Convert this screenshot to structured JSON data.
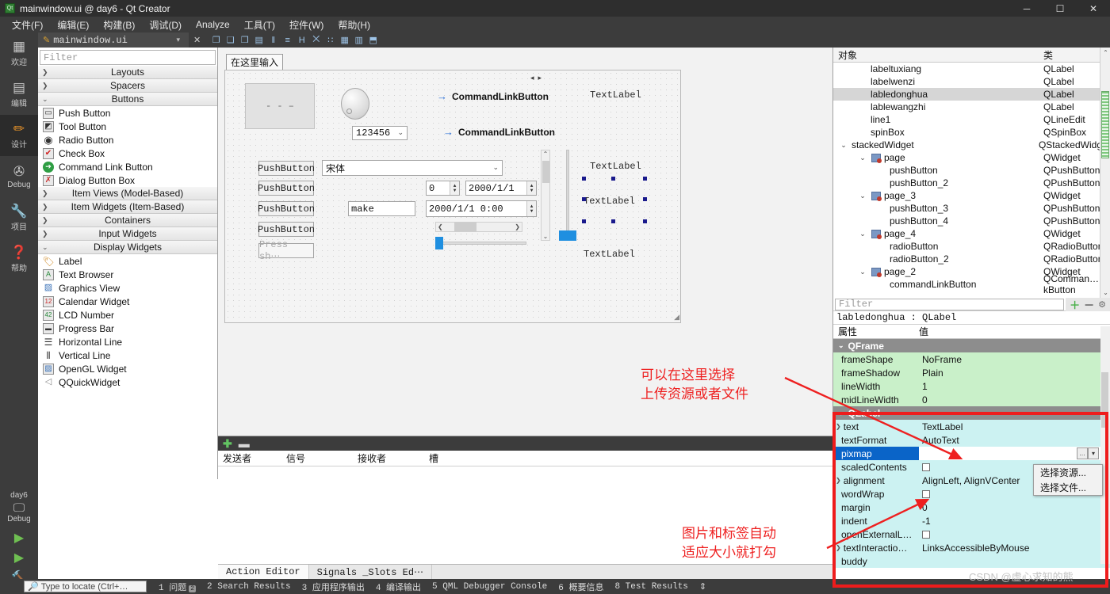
{
  "window": {
    "title": "mainwindow.ui @ day6 - Qt Creator",
    "app_icon": "qt-creator-icon",
    "minimize": "─",
    "maximize": "☐",
    "close": "✕"
  },
  "menubar": {
    "items": [
      {
        "label": "文件(F)"
      },
      {
        "label": "编辑(E)"
      },
      {
        "label": "构建(B)"
      },
      {
        "label": "调试(D)"
      },
      {
        "label": "Analyze"
      },
      {
        "label": "工具(T)"
      },
      {
        "label": "控件(W)"
      },
      {
        "label": "帮助(H)"
      }
    ]
  },
  "mode_rail": {
    "items": [
      {
        "label": "欢迎",
        "icon": "grid-icon",
        "glyph": "▓",
        "active": false
      },
      {
        "label": "编辑",
        "icon": "document-icon",
        "glyph": "☰",
        "active": false
      },
      {
        "label": "设计",
        "icon": "pencil-icon",
        "glyph": "╱",
        "active": true
      },
      {
        "label": "Debug",
        "icon": "bug-icon",
        "glyph": "✤",
        "active": false
      },
      {
        "label": "项目",
        "icon": "wrench-icon",
        "glyph": "⚒",
        "active": false
      },
      {
        "label": "帮助",
        "icon": "help-icon",
        "glyph": "?",
        "active": false
      }
    ],
    "kit_name": "day6",
    "kit_icon": "monitor-icon",
    "kit_label": "Debug",
    "run_buttons": [
      {
        "icon": "run-icon",
        "glyph": "▶"
      },
      {
        "icon": "debug-run-icon",
        "glyph": "▶"
      },
      {
        "icon": "build-hammer-icon",
        "glyph": "⚒"
      }
    ]
  },
  "editor_tab": {
    "filename": "mainwindow.ui",
    "pencil_icon": "pencil-edit-icon",
    "dropdown_icon": "chevron-down-icon",
    "close_icon": "close-icon",
    "form_tools": [
      {
        "icon": "edit-widgets-icon",
        "glyph": "❐"
      },
      {
        "icon": "edit-signals-slots-icon",
        "glyph": "❑"
      },
      {
        "icon": "edit-buddies-icon",
        "glyph": "❒"
      },
      {
        "icon": "edit-tab-order-icon",
        "glyph": "▤"
      },
      {
        "icon": "layout-horizontal-icon",
        "glyph": "‖"
      },
      {
        "icon": "layout-vertical-icon",
        "glyph": "≡"
      },
      {
        "icon": "layout-splitter-h-icon",
        "glyph": "H"
      },
      {
        "icon": "layout-splitter-v-icon",
        "glyph": "⨉"
      },
      {
        "icon": "layout-form-icon",
        "glyph": "∷"
      },
      {
        "icon": "layout-grid-icon",
        "glyph": "▦"
      },
      {
        "icon": "break-layout-icon",
        "glyph": "▥"
      },
      {
        "icon": "adjust-size-icon",
        "glyph": "⬒"
      }
    ]
  },
  "widget_box": {
    "filter_placeholder": "Filter",
    "categories": [
      {
        "label": "Layouts",
        "expanded": false,
        "items": []
      },
      {
        "label": "Spacers",
        "expanded": false,
        "items": []
      },
      {
        "label": "Buttons",
        "expanded": true,
        "items": [
          {
            "label": "Push Button",
            "icon": "push-button-icon",
            "glyph": "▭"
          },
          {
            "label": "Tool Button",
            "icon": "tool-button-icon",
            "glyph": "◩"
          },
          {
            "label": "Radio Button",
            "icon": "radio-button-icon",
            "glyph": "◉"
          },
          {
            "label": "Check Box",
            "icon": "check-box-icon",
            "glyph": "✔"
          },
          {
            "label": "Command Link Button",
            "icon": "command-link-button-icon",
            "glyph": "→"
          },
          {
            "label": "Dialog Button Box",
            "icon": "dialog-button-box-icon",
            "glyph": "✖"
          }
        ]
      },
      {
        "label": "Item Views (Model-Based)",
        "expanded": false,
        "items": []
      },
      {
        "label": "Item Widgets (Item-Based)",
        "expanded": false,
        "items": []
      },
      {
        "label": "Containers",
        "expanded": false,
        "items": []
      },
      {
        "label": "Input Widgets",
        "expanded": false,
        "items": []
      },
      {
        "label": "Display Widgets",
        "expanded": true,
        "items": [
          {
            "label": "Label",
            "icon": "label-icon",
            "glyph": "▱"
          },
          {
            "label": "Text Browser",
            "icon": "text-browser-icon",
            "glyph": "A"
          },
          {
            "label": "Graphics View",
            "icon": "graphics-view-icon",
            "glyph": "▨"
          },
          {
            "label": "Calendar Widget",
            "icon": "calendar-widget-icon",
            "glyph": "12"
          },
          {
            "label": "LCD Number",
            "icon": "lcd-number-icon",
            "glyph": "42"
          },
          {
            "label": "Progress Bar",
            "icon": "progress-bar-icon",
            "glyph": "▬"
          },
          {
            "label": "Horizontal Line",
            "icon": "horizontal-line-icon",
            "glyph": "☰"
          },
          {
            "label": "Vertical Line",
            "icon": "vertical-line-icon",
            "glyph": "‖"
          },
          {
            "label": "OpenGL Widget",
            "icon": "opengl-widget-icon",
            "glyph": "▧"
          },
          {
            "label": "QQuickWidget",
            "icon": "qquickwidget-icon",
            "glyph": "◁"
          }
        ]
      }
    ]
  },
  "form_editor": {
    "menu_placeholder": "在这里输入",
    "image_placeholder": "- -\n–",
    "dial_icon": "dial-widget",
    "combo_value": "123456",
    "font_combo_value": "宋体",
    "command_link_1": "CommandLinkButton",
    "command_link_2": "CommandLinkButton",
    "text_labels": [
      "TextLabel",
      "TextLabel",
      "TextLabel",
      "TextLabel"
    ],
    "push_buttons": [
      "PushButton",
      "PushButton",
      "PushButton",
      "PushButton"
    ],
    "key_sequence_edit": "Press sh⋯",
    "line_edit_value": "make",
    "spin_value": "0",
    "date_value": "2000/1/1",
    "datetime_value": "2000/1/1 0:00"
  },
  "signals_slots": {
    "add_icon": "plus-icon",
    "remove_icon": "minus-icon",
    "columns": [
      "发送者",
      "信号",
      "接收者",
      "槽"
    ],
    "rows": []
  },
  "bottom_tabs": [
    {
      "label": "Action Editor",
      "active": true
    },
    {
      "label": "Signals _Slots Ed⋯",
      "active": false
    }
  ],
  "object_inspector": {
    "columns": [
      "对象",
      "类"
    ],
    "rows": [
      {
        "indent": 2,
        "name": "labeltuxiang",
        "class": "QLabel",
        "twisty": "",
        "page_icon": false,
        "selected": false
      },
      {
        "indent": 2,
        "name": "labelwenzi",
        "class": "QLabel",
        "twisty": "",
        "page_icon": false,
        "selected": false
      },
      {
        "indent": 2,
        "name": "labledonghua",
        "class": "QLabel",
        "twisty": "",
        "page_icon": false,
        "selected": true
      },
      {
        "indent": 2,
        "name": "lablewangzhi",
        "class": "QLabel",
        "twisty": "",
        "page_icon": false,
        "selected": false
      },
      {
        "indent": 2,
        "name": "line1",
        "class": "QLineEdit",
        "twisty": "",
        "page_icon": false,
        "selected": false
      },
      {
        "indent": 2,
        "name": "spinBox",
        "class": "QSpinBox",
        "twisty": "",
        "page_icon": false,
        "selected": false
      },
      {
        "indent": 1,
        "name": "stackedWidget",
        "class": "QStackedWidget",
        "twisty": "⌄",
        "page_icon": false,
        "selected": false
      },
      {
        "indent": 2,
        "name": "page",
        "class": "QWidget",
        "twisty": "⌄",
        "page_icon": true,
        "selected": false
      },
      {
        "indent": 3,
        "name": "pushButton",
        "class": "QPushButton",
        "twisty": "",
        "page_icon": false,
        "selected": false
      },
      {
        "indent": 3,
        "name": "pushButton_2",
        "class": "QPushButton",
        "twisty": "",
        "page_icon": false,
        "selected": false
      },
      {
        "indent": 2,
        "name": "page_3",
        "class": "QWidget",
        "twisty": "⌄",
        "page_icon": true,
        "selected": false
      },
      {
        "indent": 3,
        "name": "pushButton_3",
        "class": "QPushButton",
        "twisty": "",
        "page_icon": false,
        "selected": false
      },
      {
        "indent": 3,
        "name": "pushButton_4",
        "class": "QPushButton",
        "twisty": "",
        "page_icon": false,
        "selected": false
      },
      {
        "indent": 2,
        "name": "page_4",
        "class": "QWidget",
        "twisty": "⌄",
        "page_icon": true,
        "selected": false
      },
      {
        "indent": 3,
        "name": "radioButton",
        "class": "QRadioButton",
        "twisty": "",
        "page_icon": false,
        "selected": false
      },
      {
        "indent": 3,
        "name": "radioButton_2",
        "class": "QRadioButton",
        "twisty": "",
        "page_icon": false,
        "selected": false
      },
      {
        "indent": 2,
        "name": "page_2",
        "class": "QWidget",
        "twisty": "⌄",
        "page_icon": true,
        "selected": false
      },
      {
        "indent": 3,
        "name": "commandLinkButton",
        "class": "QComman…kButton",
        "twisty": "",
        "page_icon": false,
        "selected": false
      }
    ]
  },
  "property_editor": {
    "filter_placeholder": "Filter",
    "toolbar_icons": [
      {
        "icon": "add-property-icon",
        "glyph": "＋"
      },
      {
        "icon": "remove-property-icon",
        "glyph": "－"
      },
      {
        "icon": "configure-icon",
        "glyph": "⚙"
      }
    ],
    "object_header": "labledonghua : QLabel",
    "columns": [
      "属性",
      "值"
    ],
    "groups": [
      {
        "name": "QFrame",
        "expanded": true,
        "rows": [
          {
            "name": "frameShape",
            "value": "NoFrame",
            "type": "text",
            "tint": "green",
            "twisty": false
          },
          {
            "name": "frameShadow",
            "value": "Plain",
            "type": "text",
            "tint": "green",
            "twisty": false
          },
          {
            "name": "lineWidth",
            "value": "1",
            "type": "text",
            "tint": "green",
            "twisty": false
          },
          {
            "name": "midLineWidth",
            "value": "0",
            "type": "text",
            "tint": "green",
            "twisty": false
          }
        ]
      },
      {
        "name": "QLabel",
        "expanded": true,
        "rows": [
          {
            "name": "text",
            "value": "TextLabel",
            "type": "text",
            "tint": "cyan",
            "twisty": true
          },
          {
            "name": "textFormat",
            "value": "AutoText",
            "type": "text",
            "tint": "cyan",
            "twisty": false
          },
          {
            "name": "pixmap",
            "value": "",
            "type": "pixmap",
            "tint": "sel",
            "twisty": false
          },
          {
            "name": "scaledContents",
            "value": "",
            "type": "checkbox",
            "tint": "cyan",
            "twisty": false
          },
          {
            "name": "alignment",
            "value": "AlignLeft, AlignVCenter",
            "type": "text",
            "tint": "cyan",
            "twisty": true
          },
          {
            "name": "wordWrap",
            "value": "",
            "type": "checkbox",
            "tint": "cyan",
            "twisty": false
          },
          {
            "name": "margin",
            "value": "0",
            "type": "text",
            "tint": "cyan",
            "twisty": false
          },
          {
            "name": "indent",
            "value": "-1",
            "type": "text",
            "tint": "cyan",
            "twisty": false
          },
          {
            "name": "openExternalL…",
            "value": "",
            "type": "checkbox",
            "tint": "cyan",
            "twisty": false
          },
          {
            "name": "textInteractio…",
            "value": "LinksAccessibleByMouse",
            "type": "text",
            "tint": "cyan",
            "twisty": true
          },
          {
            "name": "buddy",
            "value": "",
            "type": "text",
            "tint": "cyan",
            "twisty": false
          }
        ]
      }
    ],
    "context_menu": {
      "items": [
        {
          "label": "选择资源..."
        },
        {
          "label": "选择文件..."
        }
      ]
    }
  },
  "annotations": {
    "accent_color": "#ee2020",
    "note_1": "可以在这里选择\n上传资源或者文件",
    "note_2": "图片和标签自动\n适应大小就打勾",
    "watermark": "CSDN @虚心求知的熊"
  },
  "status_bar": {
    "locator_icon": "search-icon",
    "locator_placeholder": "Type to locate (Ctrl+…",
    "panes": [
      {
        "num": "1",
        "label": "问题",
        "badge": "2"
      },
      {
        "num": "2",
        "label": "Search Results",
        "badge": ""
      },
      {
        "num": "3",
        "label": "应用程序输出",
        "badge": ""
      },
      {
        "num": "4",
        "label": "编译输出",
        "badge": ""
      },
      {
        "num": "5",
        "label": "QML Debugger Console",
        "badge": ""
      },
      {
        "num": "6",
        "label": "概要信息",
        "badge": ""
      },
      {
        "num": "8",
        "label": "Test Results",
        "badge": ""
      }
    ],
    "updown_icon": "up-down-icon"
  }
}
